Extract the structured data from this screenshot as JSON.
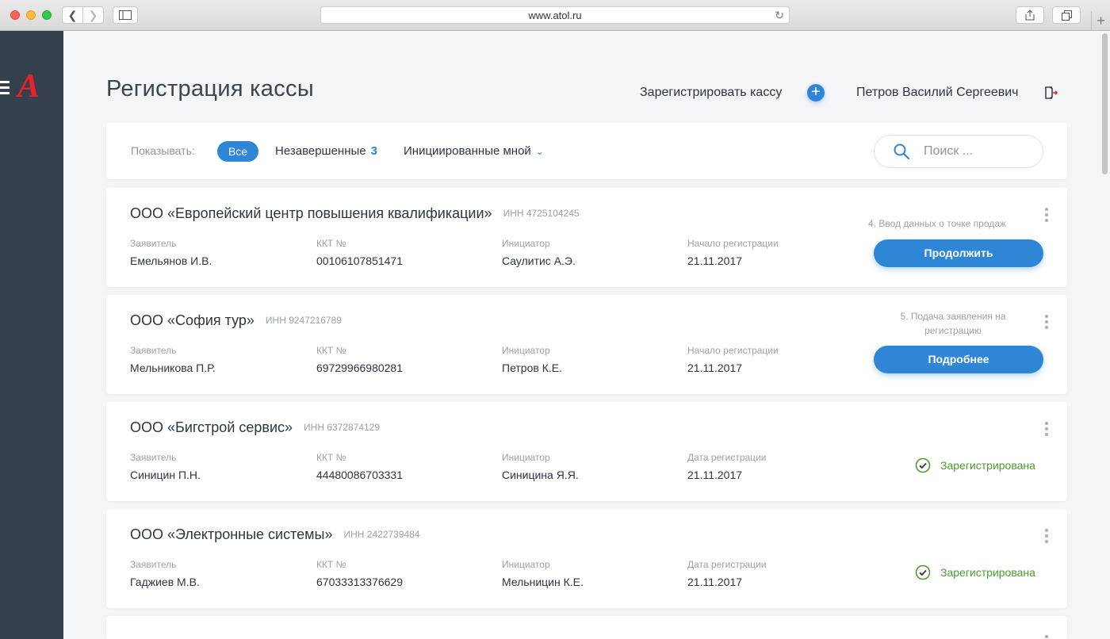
{
  "browser": {
    "url": "www.atol.ru"
  },
  "header": {
    "title": "Регистрация кассы",
    "register_label": "Зарегистрировать кассу",
    "user_name": "Петров Василий Сергеевич"
  },
  "filters": {
    "label": "Показывать:",
    "all": "Все",
    "unfinished": "Незавершенные",
    "unfinished_count": "3",
    "mine": "Инициированные мной",
    "search_placeholder": "Поиск ..."
  },
  "cards": [
    {
      "title": "ООО «Европейский центр повышения квалификации»",
      "inn": "ИНН 4725104245",
      "applicant_label": "Заявитель",
      "applicant": "Емельянов И.В.",
      "kkt_label": "ККТ №",
      "kkt": "00106107851471",
      "initiator_label": "Инициатор",
      "initiator": "Саулитис А.Э.",
      "date_label": "Начало регистрации",
      "date": "21.11.2017",
      "step": "4. Ввод данных о точке продаж",
      "action": "Продолжить"
    },
    {
      "title": "ООО «София тур»",
      "inn": "ИНН 9247216789",
      "applicant_label": "Заявитель",
      "applicant": "Мельникова П.Р.",
      "kkt_label": "ККТ №",
      "kkt": "69729966980281",
      "initiator_label": "Инициатор",
      "initiator": "Петров К.Е.",
      "date_label": "Начало регистрации",
      "date": "21.11.2017",
      "step_line1": "5. Подача заявления на",
      "step_line2": "регистрацию",
      "action": "Подробнее"
    },
    {
      "title": "ООО «Бигстрой сервис»",
      "inn": "ИНН 6372874129",
      "applicant_label": "Заявитель",
      "applicant": "Синицин П.Н.",
      "kkt_label": "ККТ №",
      "kkt": "44480086703331",
      "initiator_label": "Инициатор",
      "initiator": "Синицина Я.Я.",
      "date_label": "Дата регистрации",
      "date": "21.11.2017",
      "status": "Зарегистрирована"
    },
    {
      "title": "ООО «Электронные системы»",
      "inn": "ИНН 2422739484",
      "applicant_label": "Заявитель",
      "applicant": "Гаджиев М.В.",
      "kkt_label": "ККТ №",
      "kkt": "67033313376629",
      "initiator_label": "Инициатор",
      "initiator": "Мельницин К.Е.",
      "date_label": "Дата регистрации",
      "date": "21.11.2017",
      "status": "Зарегистрирована"
    }
  ],
  "colors": {
    "accent": "#2f86d6",
    "sidebar": "#34404b",
    "logo": "#e6232b",
    "success": "#4c9c2e"
  }
}
